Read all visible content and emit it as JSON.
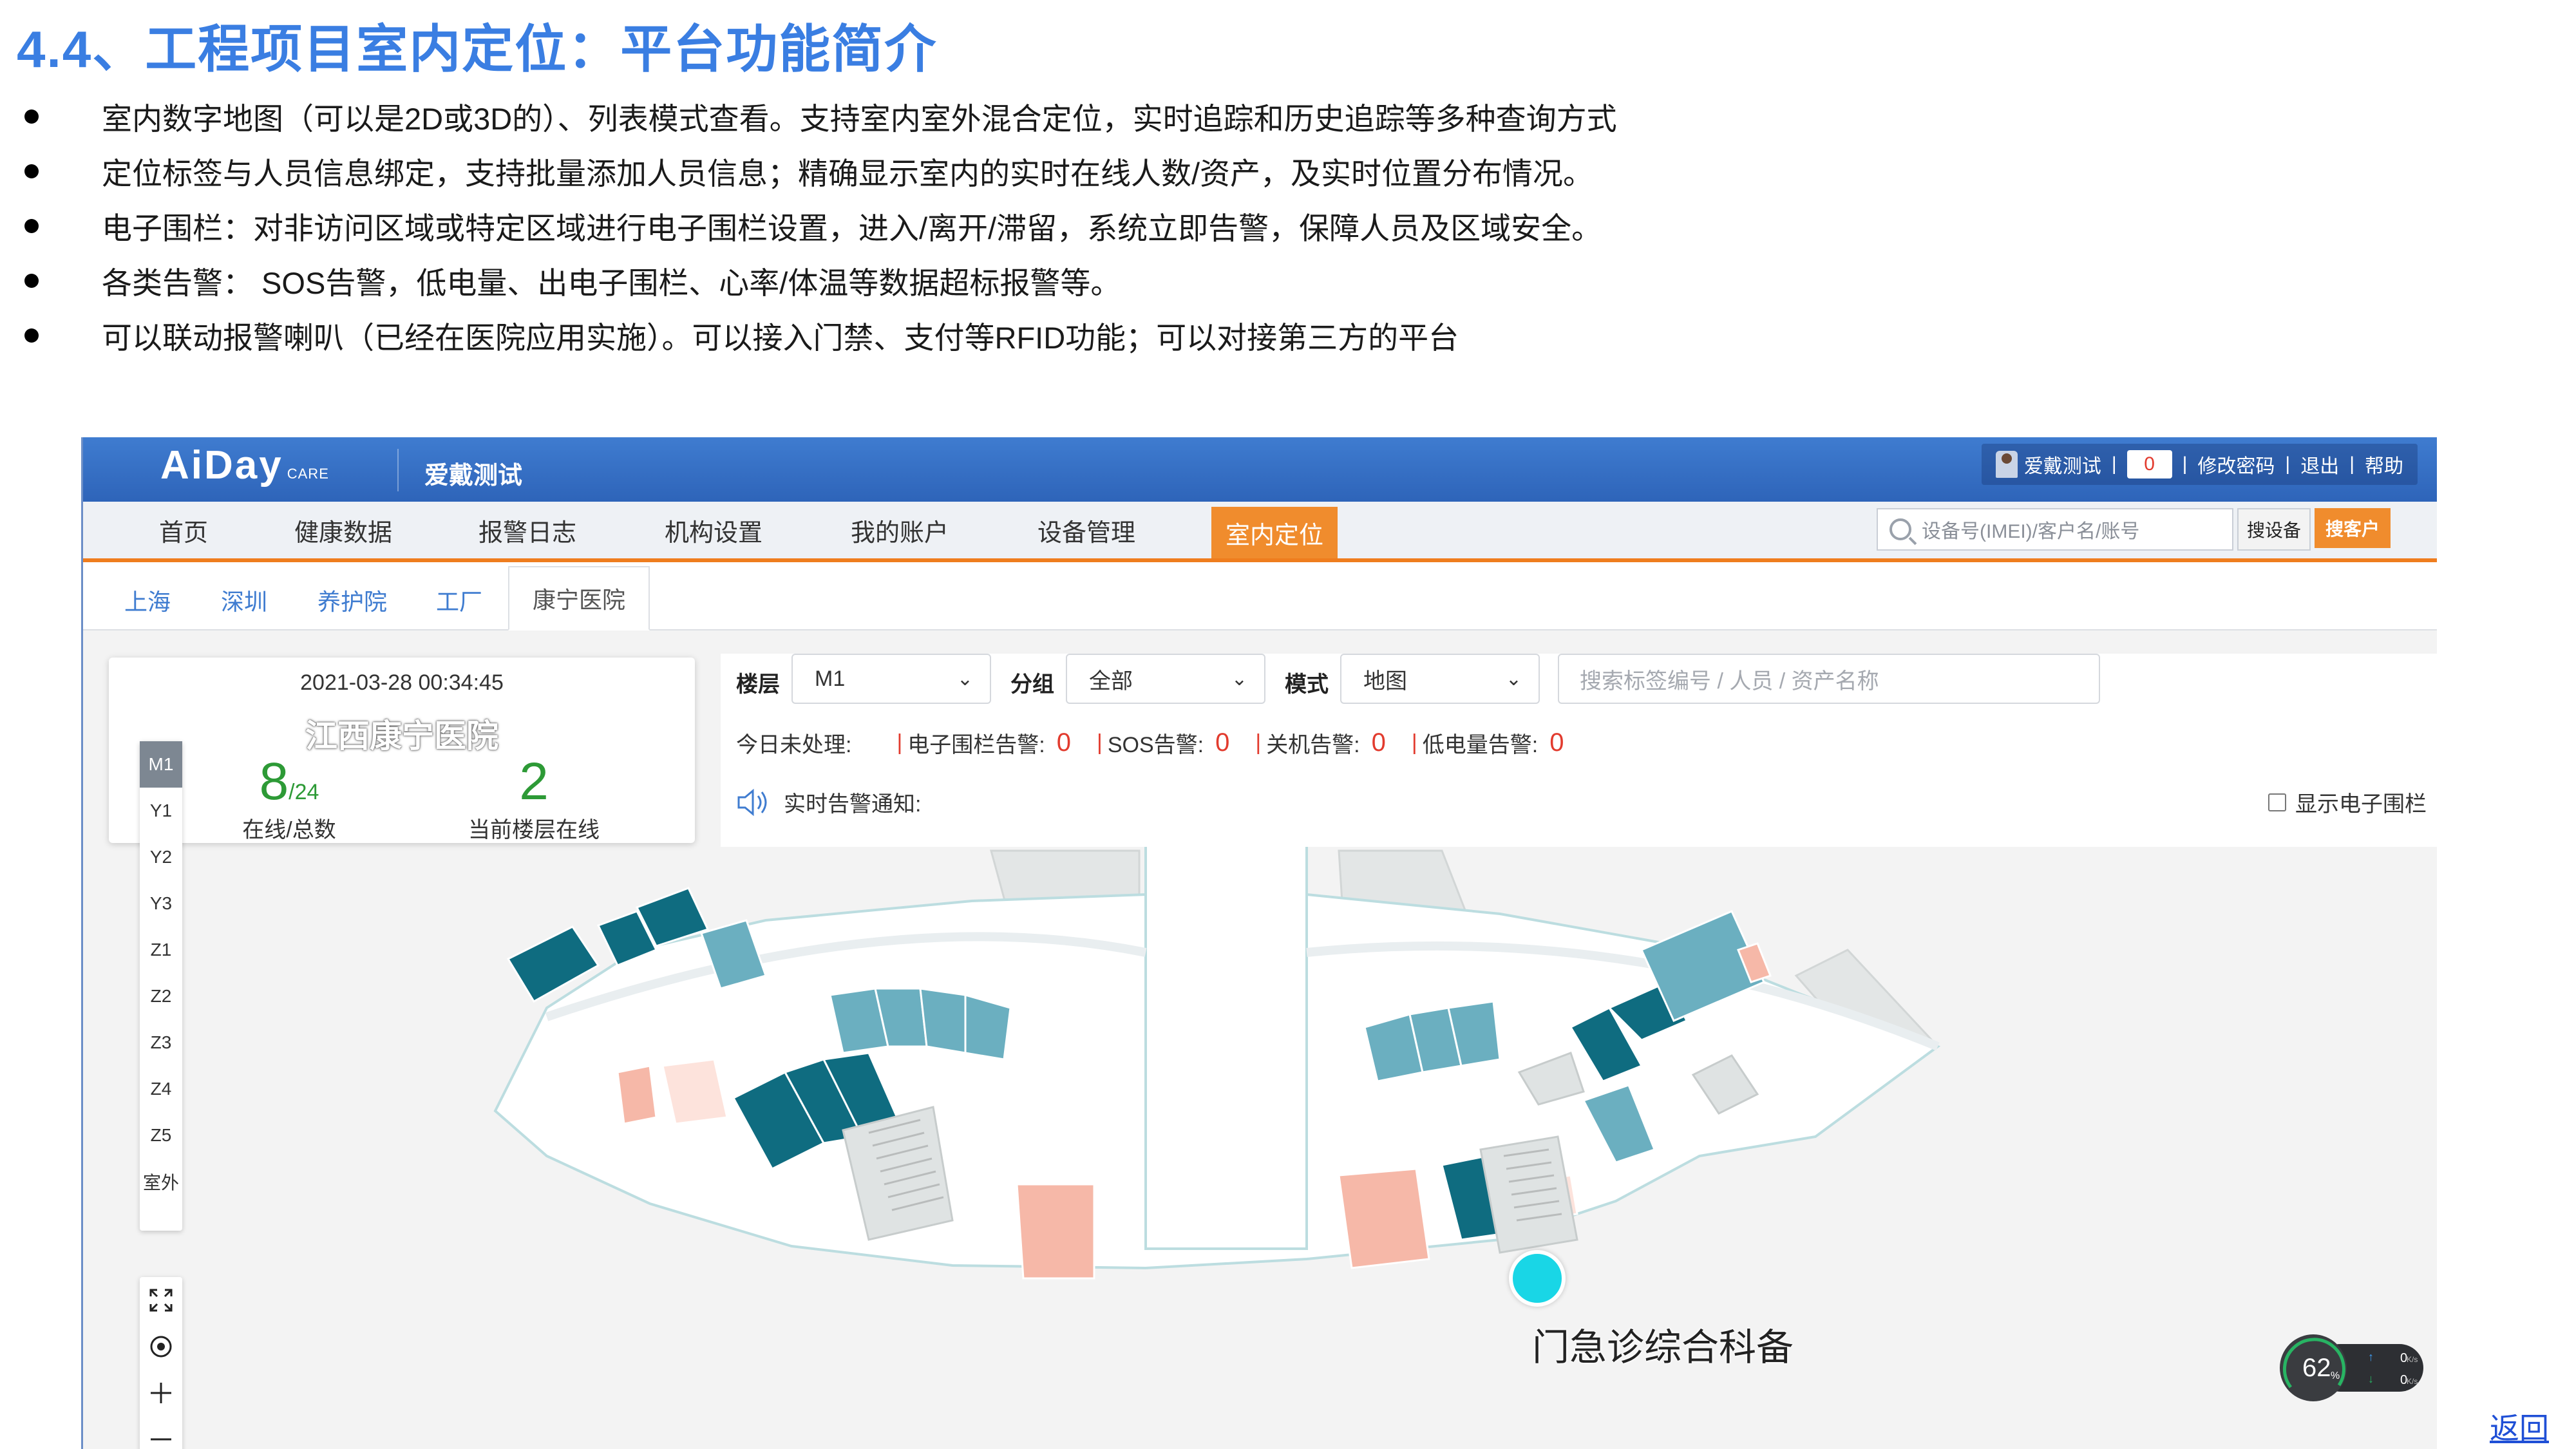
{
  "slide": {
    "title": "4.4、工程项目室内定位：平台功能简介",
    "bullets": [
      "室内数字地图（可以是2D或3D的）、列表模式查看。支持室内室外混合定位，实时追踪和历史追踪等多种查询方式",
      "定位标签与人员信息绑定，支持批量添加人员信息；精确显示室内的实时在线人数/资产，及实时位置分布情况。",
      "电子围栏：对非访问区域或特定区域进行电子围栏设置，进入/离开/滞留，系统立即告警，保障人员及区域安全。",
      "各类告警： SOS告警，低电量、出电子围栏、心率/体温等数据超标报警等。",
      "可以联动报警喇叭（已经在医院应用实施）。可以接入门禁、支付等RFID功能；可以对接第三方的平台"
    ],
    "back_link": "返回"
  },
  "app": {
    "logo": "AiDay",
    "logo_sub": "CARE",
    "brand_name": "爱戴测试",
    "user": {
      "name": "爱戴测试",
      "count": "0",
      "links": [
        "修改密码",
        "退出",
        "帮助"
      ]
    },
    "nav": [
      "首页",
      "健康数据",
      "报警日志",
      "机构设置",
      "我的账户",
      "设备管理",
      "室内定位"
    ],
    "nav_active_index": 6,
    "search": {
      "placeholder": "设备号(IMEI)/客户名/账号",
      "device_button": "搜设备",
      "customer_button": "搜客户"
    },
    "city_tabs": [
      "上海",
      "深圳",
      "养护院",
      "工厂",
      "康宁医院"
    ],
    "city_active_index": 4,
    "info_card": {
      "time": "2021-03-28 00:34:45",
      "name": "江西康宁医院",
      "online": "8",
      "total": "/24",
      "online_label": "在线/总数",
      "floor_online": "2",
      "floor_online_label": "当前楼层在线"
    },
    "floors": [
      "M1",
      "Y1",
      "Y2",
      "Y3",
      "Z1",
      "Z2",
      "Z3",
      "Z4",
      "Z5",
      "室外"
    ],
    "floor_active": "M1",
    "tools": [
      "fullscreen-icon",
      "locate-icon",
      "zoom-in-icon",
      "zoom-out-icon"
    ],
    "filters": {
      "floor_label": "楼层",
      "floor_value": "M1",
      "group_label": "分组",
      "group_value": "全部",
      "mode_label": "模式",
      "mode_value": "地图",
      "tag_placeholder": "搜索标签编号 / 人员 / 资产名称"
    },
    "alarms": {
      "today_label": "今日未处理:",
      "items": [
        {
          "label": "电子围栏告警:",
          "value": "0"
        },
        {
          "label": "SOS告警:",
          "value": "0"
        },
        {
          "label": "关机告警:",
          "value": "0"
        },
        {
          "label": "低电量告警:",
          "value": "0"
        }
      ],
      "realtime_label": "实时告警通知:",
      "show_fence_label": "显示电子围栏"
    },
    "map": {
      "zone_label": "门急诊综合科备",
      "network": {
        "percent": "62",
        "percent_unit": "%",
        "up": "0",
        "down": "0",
        "unit": "K/s"
      }
    },
    "colors": {
      "accent": "#3f7cd0",
      "orange": "#f08c2d",
      "teal": "#0f6c80",
      "online": "#2d9a36"
    }
  }
}
